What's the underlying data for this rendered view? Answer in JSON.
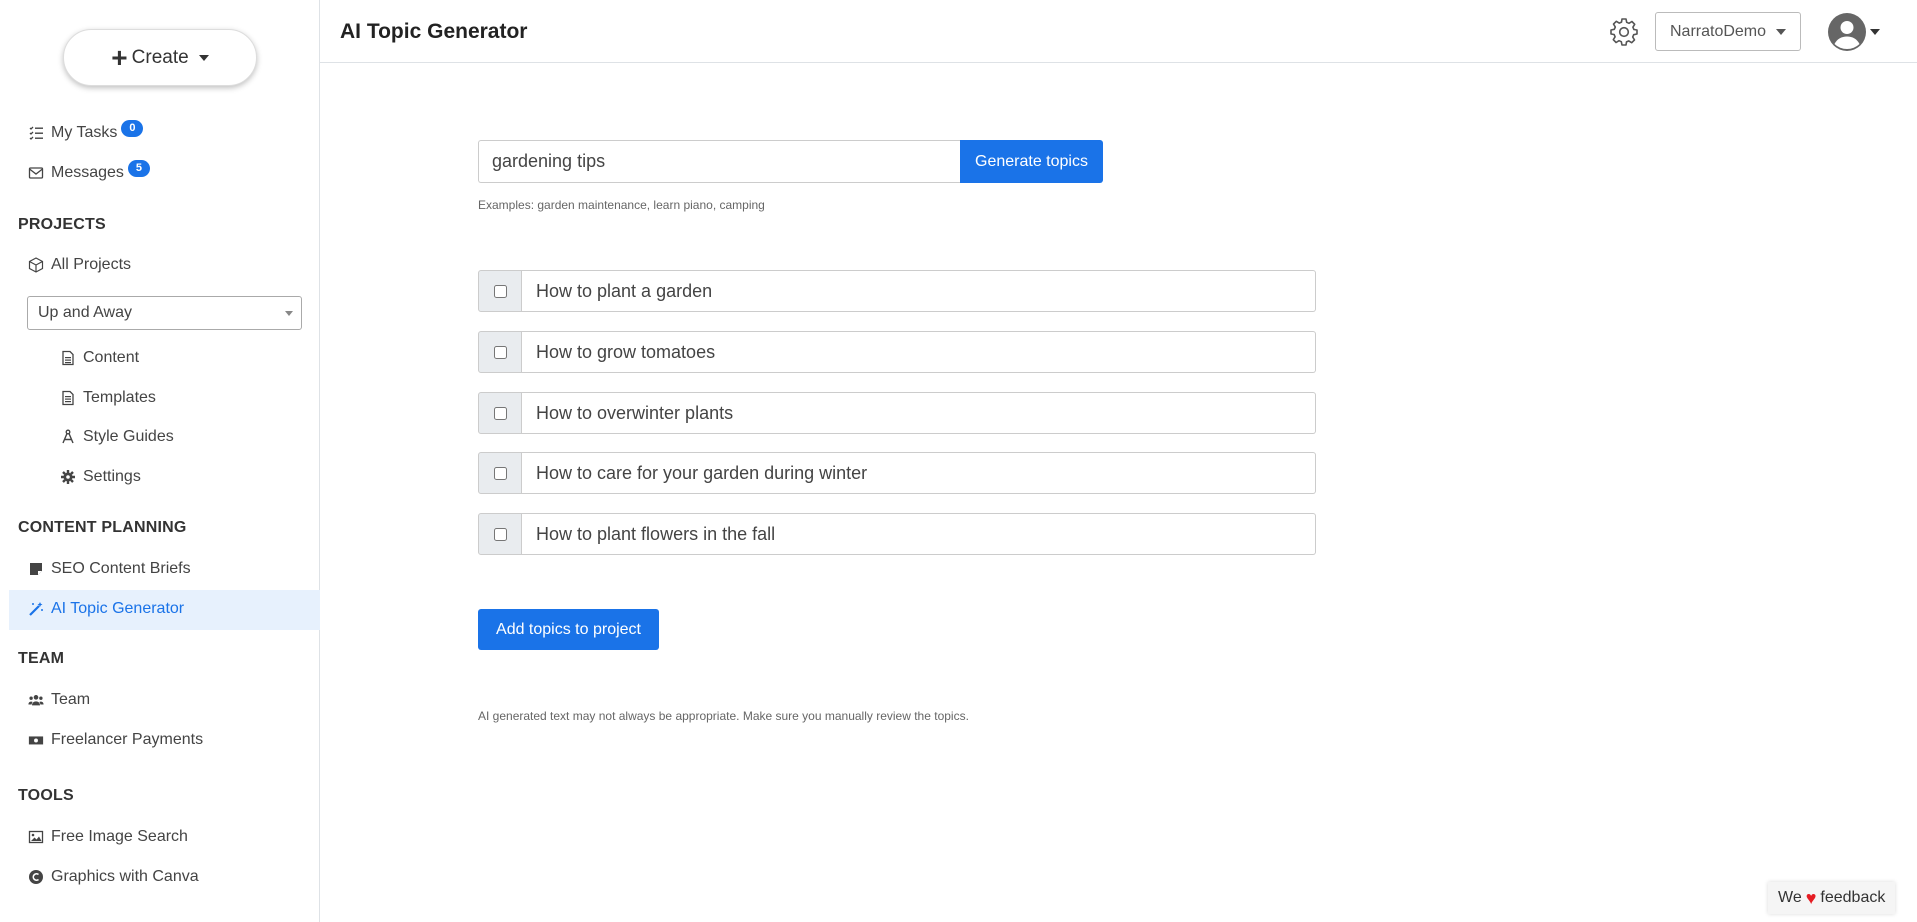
{
  "sidebar": {
    "create_label": "Create",
    "my_tasks": {
      "label": "My Tasks",
      "badge": "0"
    },
    "messages": {
      "label": "Messages",
      "badge": "5"
    },
    "projects_title": "PROJECTS",
    "all_projects": "All Projects",
    "project_selected": "Up and Away",
    "project_items": [
      "Content",
      "Templates",
      "Style Guides",
      "Settings"
    ],
    "content_planning_title": "CONTENT PLANNING",
    "seo_briefs": "SEO Content Briefs",
    "ai_topic_generator": "AI Topic Generator",
    "team_title": "TEAM",
    "team": "Team",
    "freelancer_payments": "Freelancer Payments",
    "tools_title": "TOOLS",
    "free_image_search": "Free Image Search",
    "graphics_canva": "Graphics with Canva"
  },
  "header": {
    "title": "AI Topic Generator",
    "account": "NarratoDemo"
  },
  "main": {
    "search_value": "gardening tips",
    "generate_label": "Generate topics",
    "hint": "Examples: garden maintenance, learn piano, camping",
    "topics": [
      "How to plant a garden",
      "How to grow tomatoes",
      "How to overwinter plants",
      "How to care for your garden during winter",
      "How to plant flowers in the fall"
    ],
    "add_label": "Add topics to project",
    "disclaimer": "AI generated text may not always be appropriate. Make sure you manually review the topics."
  },
  "feedback": {
    "pre": "We",
    "post": "feedback"
  },
  "colors": {
    "accent": "#1a73e8",
    "active_bg": "#e7f1fd",
    "heart": "#e51c23"
  }
}
